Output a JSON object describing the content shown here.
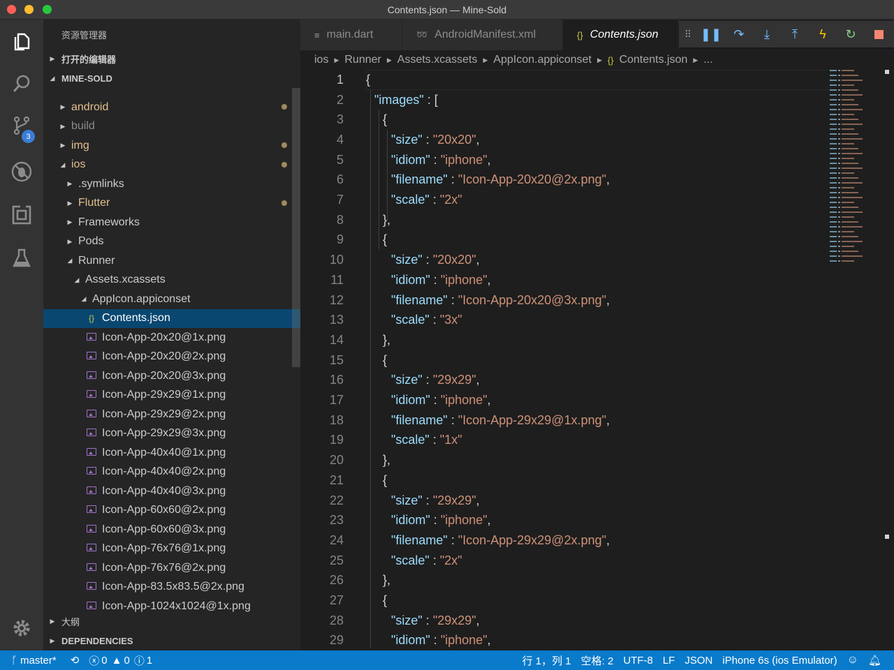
{
  "window": {
    "title": "Contents.json — Mine-Sold"
  },
  "activity_bar": {
    "items": [
      "explorer-icon",
      "search-icon",
      "source-control-icon",
      "debug-icon",
      "extensions-icon",
      "test-flask-icon"
    ],
    "source_control_badge": "3",
    "settings": "gear-icon"
  },
  "sidebar": {
    "header": "资源管理器",
    "open_editors": "打开的编辑器",
    "project": "MINE-SOLD",
    "outline": "大纲",
    "dependencies": "DEPENDENCIES",
    "tree": [
      {
        "label": "android",
        "depth": 1,
        "type": "folder",
        "expanded": false,
        "modified": true
      },
      {
        "label": "build",
        "depth": 1,
        "type": "folder",
        "expanded": false,
        "modified": false,
        "dim": true
      },
      {
        "label": "img",
        "depth": 1,
        "type": "folder",
        "expanded": false,
        "modified": true
      },
      {
        "label": "ios",
        "depth": 1,
        "type": "folder",
        "expanded": true,
        "modified": true
      },
      {
        "label": ".symlinks",
        "depth": 2,
        "type": "folder",
        "expanded": false,
        "modified": false
      },
      {
        "label": "Flutter",
        "depth": 2,
        "type": "folder",
        "expanded": false,
        "modified": true
      },
      {
        "label": "Frameworks",
        "depth": 2,
        "type": "folder",
        "expanded": false,
        "modified": false
      },
      {
        "label": "Pods",
        "depth": 2,
        "type": "folder",
        "expanded": false,
        "modified": false
      },
      {
        "label": "Runner",
        "depth": 2,
        "type": "folder",
        "expanded": true,
        "modified": false
      },
      {
        "label": "Assets.xcassets",
        "depth": 3,
        "type": "folder",
        "expanded": true,
        "modified": false
      },
      {
        "label": "AppIcon.appiconset",
        "depth": 4,
        "type": "folder",
        "expanded": true,
        "modified": false
      },
      {
        "label": "Contents.json",
        "depth": 5,
        "type": "json",
        "selected": true
      },
      {
        "label": "Icon-App-20x20@1x.png",
        "depth": 5,
        "type": "image"
      },
      {
        "label": "Icon-App-20x20@2x.png",
        "depth": 5,
        "type": "image"
      },
      {
        "label": "Icon-App-20x20@3x.png",
        "depth": 5,
        "type": "image"
      },
      {
        "label": "Icon-App-29x29@1x.png",
        "depth": 5,
        "type": "image"
      },
      {
        "label": "Icon-App-29x29@2x.png",
        "depth": 5,
        "type": "image"
      },
      {
        "label": "Icon-App-29x29@3x.png",
        "depth": 5,
        "type": "image"
      },
      {
        "label": "Icon-App-40x40@1x.png",
        "depth": 5,
        "type": "image"
      },
      {
        "label": "Icon-App-40x40@2x.png",
        "depth": 5,
        "type": "image"
      },
      {
        "label": "Icon-App-40x40@3x.png",
        "depth": 5,
        "type": "image"
      },
      {
        "label": "Icon-App-60x60@2x.png",
        "depth": 5,
        "type": "image"
      },
      {
        "label": "Icon-App-60x60@3x.png",
        "depth": 5,
        "type": "image"
      },
      {
        "label": "Icon-App-76x76@1x.png",
        "depth": 5,
        "type": "image"
      },
      {
        "label": "Icon-App-76x76@2x.png",
        "depth": 5,
        "type": "image"
      },
      {
        "label": "Icon-App-83.5x83.5@2x.png",
        "depth": 5,
        "type": "image"
      },
      {
        "label": "Icon-App-1024x1024@1x.png",
        "depth": 5,
        "type": "image"
      }
    ]
  },
  "tabs": [
    {
      "label": "main.dart",
      "icon": "≡",
      "active": false
    },
    {
      "label": "AndroidManifest.xml",
      "icon": "⁾",
      "active": false
    },
    {
      "label": "Contents.json",
      "icon": "{}",
      "active": true
    }
  ],
  "debug_toolbar": [
    "drag-handle-icon",
    "pause-icon",
    "step-over-icon",
    "step-into-icon",
    "step-out-icon",
    "hot-reload-icon",
    "restart-icon",
    "stop-icon"
  ],
  "breadcrumb": [
    "ios",
    "Runner",
    "Assets.xcassets",
    "AppIcon.appiconset",
    "Contents.json",
    "..."
  ],
  "editor": {
    "current_line": 1,
    "lines": [
      {
        "n": "1",
        "i": 0,
        "t": [
          [
            "pun",
            "{"
          ]
        ]
      },
      {
        "n": "2",
        "i": 1,
        "t": [
          [
            "key",
            "\"images\""
          ],
          [
            "pun",
            " : ["
          ]
        ]
      },
      {
        "n": "3",
        "i": 2,
        "t": [
          [
            "pun",
            "{"
          ]
        ]
      },
      {
        "n": "4",
        "i": 3,
        "t": [
          [
            "key",
            "\"size\""
          ],
          [
            "pun",
            " : "
          ],
          [
            "str",
            "\"20x20\""
          ],
          [
            "pun",
            ","
          ]
        ]
      },
      {
        "n": "5",
        "i": 3,
        "t": [
          [
            "key",
            "\"idiom\""
          ],
          [
            "pun",
            " : "
          ],
          [
            "str",
            "\"iphone\""
          ],
          [
            "pun",
            ","
          ]
        ]
      },
      {
        "n": "6",
        "i": 3,
        "t": [
          [
            "key",
            "\"filename\""
          ],
          [
            "pun",
            " : "
          ],
          [
            "str",
            "\"Icon-App-20x20@2x.png\""
          ],
          [
            "pun",
            ","
          ]
        ]
      },
      {
        "n": "7",
        "i": 3,
        "t": [
          [
            "key",
            "\"scale\""
          ],
          [
            "pun",
            " : "
          ],
          [
            "str",
            "\"2x\""
          ]
        ]
      },
      {
        "n": "8",
        "i": 2,
        "t": [
          [
            "pun",
            "},"
          ]
        ]
      },
      {
        "n": "9",
        "i": 2,
        "t": [
          [
            "pun",
            "{"
          ]
        ]
      },
      {
        "n": "10",
        "i": 3,
        "t": [
          [
            "key",
            "\"size\""
          ],
          [
            "pun",
            " : "
          ],
          [
            "str",
            "\"20x20\""
          ],
          [
            "pun",
            ","
          ]
        ]
      },
      {
        "n": "11",
        "i": 3,
        "t": [
          [
            "key",
            "\"idiom\""
          ],
          [
            "pun",
            " : "
          ],
          [
            "str",
            "\"iphone\""
          ],
          [
            "pun",
            ","
          ]
        ]
      },
      {
        "n": "12",
        "i": 3,
        "t": [
          [
            "key",
            "\"filename\""
          ],
          [
            "pun",
            " : "
          ],
          [
            "str",
            "\"Icon-App-20x20@3x.png\""
          ],
          [
            "pun",
            ","
          ]
        ]
      },
      {
        "n": "13",
        "i": 3,
        "t": [
          [
            "key",
            "\"scale\""
          ],
          [
            "pun",
            " : "
          ],
          [
            "str",
            "\"3x\""
          ]
        ]
      },
      {
        "n": "14",
        "i": 2,
        "t": [
          [
            "pun",
            "},"
          ]
        ]
      },
      {
        "n": "15",
        "i": 2,
        "t": [
          [
            "pun",
            "{"
          ]
        ]
      },
      {
        "n": "16",
        "i": 3,
        "t": [
          [
            "key",
            "\"size\""
          ],
          [
            "pun",
            " : "
          ],
          [
            "str",
            "\"29x29\""
          ],
          [
            "pun",
            ","
          ]
        ]
      },
      {
        "n": "17",
        "i": 3,
        "t": [
          [
            "key",
            "\"idiom\""
          ],
          [
            "pun",
            " : "
          ],
          [
            "str",
            "\"iphone\""
          ],
          [
            "pun",
            ","
          ]
        ]
      },
      {
        "n": "18",
        "i": 3,
        "t": [
          [
            "key",
            "\"filename\""
          ],
          [
            "pun",
            " : "
          ],
          [
            "str",
            "\"Icon-App-29x29@1x.png\""
          ],
          [
            "pun",
            ","
          ]
        ]
      },
      {
        "n": "19",
        "i": 3,
        "t": [
          [
            "key",
            "\"scale\""
          ],
          [
            "pun",
            " : "
          ],
          [
            "str",
            "\"1x\""
          ]
        ]
      },
      {
        "n": "20",
        "i": 2,
        "t": [
          [
            "pun",
            "},"
          ]
        ]
      },
      {
        "n": "21",
        "i": 2,
        "t": [
          [
            "pun",
            "{"
          ]
        ]
      },
      {
        "n": "22",
        "i": 3,
        "t": [
          [
            "key",
            "\"size\""
          ],
          [
            "pun",
            " : "
          ],
          [
            "str",
            "\"29x29\""
          ],
          [
            "pun",
            ","
          ]
        ]
      },
      {
        "n": "23",
        "i": 3,
        "t": [
          [
            "key",
            "\"idiom\""
          ],
          [
            "pun",
            " : "
          ],
          [
            "str",
            "\"iphone\""
          ],
          [
            "pun",
            ","
          ]
        ]
      },
      {
        "n": "24",
        "i": 3,
        "t": [
          [
            "key",
            "\"filename\""
          ],
          [
            "pun",
            " : "
          ],
          [
            "str",
            "\"Icon-App-29x29@2x.png\""
          ],
          [
            "pun",
            ","
          ]
        ]
      },
      {
        "n": "25",
        "i": 3,
        "t": [
          [
            "key",
            "\"scale\""
          ],
          [
            "pun",
            " : "
          ],
          [
            "str",
            "\"2x\""
          ]
        ]
      },
      {
        "n": "26",
        "i": 2,
        "t": [
          [
            "pun",
            "},"
          ]
        ]
      },
      {
        "n": "27",
        "i": 2,
        "t": [
          [
            "pun",
            "{"
          ]
        ]
      },
      {
        "n": "28",
        "i": 3,
        "t": [
          [
            "key",
            "\"size\""
          ],
          [
            "pun",
            " : "
          ],
          [
            "str",
            "\"29x29\""
          ],
          [
            "pun",
            ","
          ]
        ]
      },
      {
        "n": "29",
        "i": 3,
        "t": [
          [
            "key",
            "\"idiom\""
          ],
          [
            "pun",
            " : "
          ],
          [
            "str",
            "\"iphone\""
          ],
          [
            "pun",
            ","
          ]
        ]
      }
    ]
  },
  "statusbar": {
    "branch": "master*",
    "errors": "0",
    "warnings": "0",
    "info": "1",
    "position": "行 1，列 1",
    "indent": "空格: 2",
    "encoding": "UTF-8",
    "eol": "LF",
    "language": "JSON",
    "device": "iPhone 6s (ios Emulator)"
  },
  "colors": {
    "accent_blue": "#0a7aca",
    "selection": "#094771",
    "json_key": "#9cdcfe",
    "json_string": "#ce9178",
    "modified": "#e2c08d"
  }
}
